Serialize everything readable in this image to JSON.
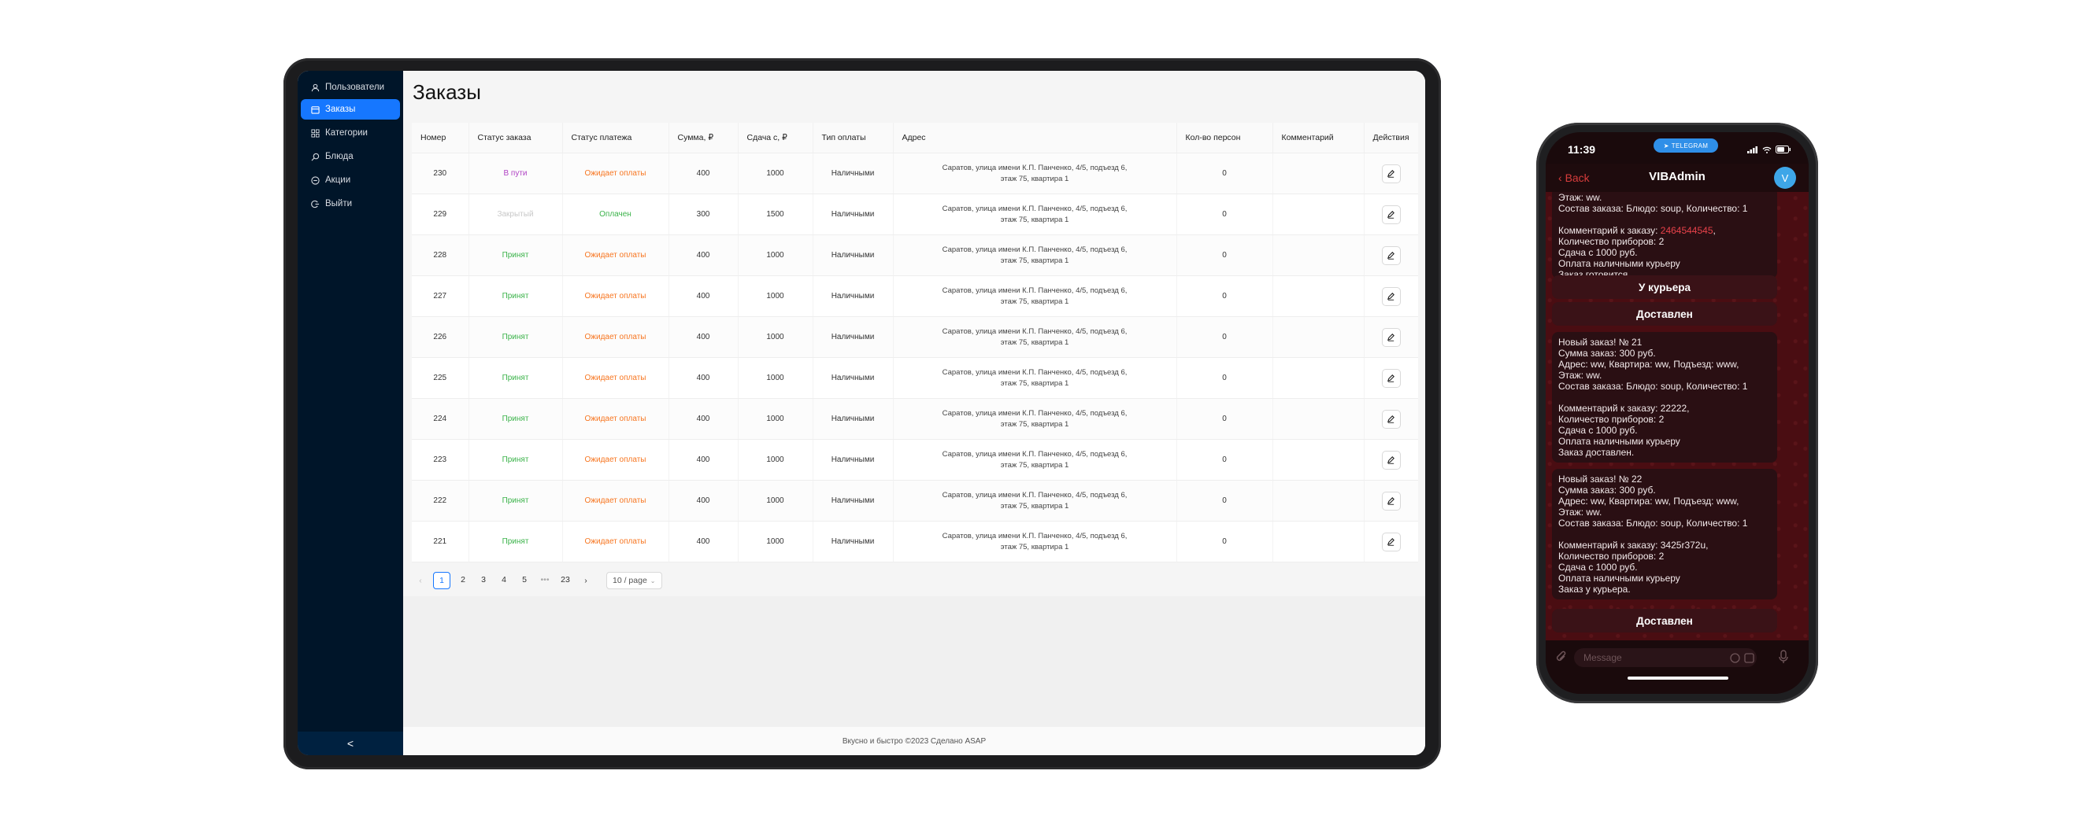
{
  "admin": {
    "title": "Заказы",
    "sidebar": [
      {
        "label": "Пользователи",
        "icon": "user-icon"
      },
      {
        "label": "Заказы",
        "icon": "calendar-icon",
        "active": true
      },
      {
        "label": "Категории",
        "icon": "grid-icon"
      },
      {
        "label": "Блюда",
        "icon": "search-icon"
      },
      {
        "label": "Акции",
        "icon": "tag-icon"
      },
      {
        "label": "Выйти",
        "icon": "logout-icon"
      }
    ],
    "collapse_label": "<",
    "columns": [
      "Номер",
      "Статус заказа",
      "Статус платежа",
      "Сумма, ₽",
      "Сдача с, ₽",
      "Тип оплаты",
      "Адрес",
      "Кол-во персон",
      "Комментарий",
      "Действия"
    ],
    "rows": [
      {
        "num": "230",
        "status": "В пути",
        "status_kind": "way",
        "pay": "Ожидает оплаты",
        "pay_kind": "wait",
        "sum": "400",
        "change": "1000",
        "type": "Наличными",
        "addr1": "Саратов, улица имени К.П. Панченко, 4/5, подъезд 6,",
        "addr2": "этаж 75, квартира 1",
        "persons": "0",
        "comment": ""
      },
      {
        "num": "229",
        "status": "Закрытый",
        "status_kind": "closed",
        "pay": "Оплачен",
        "pay_kind": "paid",
        "sum": "300",
        "change": "1500",
        "type": "Наличными",
        "addr1": "Саратов, улица имени К.П. Панченко, 4/5, подъезд 6,",
        "addr2": "этаж 75, квартира 1",
        "persons": "0",
        "comment": ""
      },
      {
        "num": "228",
        "status": "Принят",
        "status_kind": "accepted",
        "pay": "Ожидает оплаты",
        "pay_kind": "wait",
        "sum": "400",
        "change": "1000",
        "type": "Наличными",
        "addr1": "Саратов, улица имени К.П. Панченко, 4/5, подъезд 6,",
        "addr2": "этаж 75, квартира 1",
        "persons": "0",
        "comment": ""
      },
      {
        "num": "227",
        "status": "Принят",
        "status_kind": "accepted",
        "pay": "Ожидает оплаты",
        "pay_kind": "wait",
        "sum": "400",
        "change": "1000",
        "type": "Наличными",
        "addr1": "Саратов, улица имени К.П. Панченко, 4/5, подъезд 6,",
        "addr2": "этаж 75, квартира 1",
        "persons": "0",
        "comment": ""
      },
      {
        "num": "226",
        "status": "Принят",
        "status_kind": "accepted",
        "pay": "Ожидает оплаты",
        "pay_kind": "wait",
        "sum": "400",
        "change": "1000",
        "type": "Наличными",
        "addr1": "Саратов, улица имени К.П. Панченко, 4/5, подъезд 6,",
        "addr2": "этаж 75, квартира 1",
        "persons": "0",
        "comment": ""
      },
      {
        "num": "225",
        "status": "Принят",
        "status_kind": "accepted",
        "pay": "Ожидает оплаты",
        "pay_kind": "wait",
        "sum": "400",
        "change": "1000",
        "type": "Наличными",
        "addr1": "Саратов, улица имени К.П. Панченко, 4/5, подъезд 6,",
        "addr2": "этаж 75, квартира 1",
        "persons": "0",
        "comment": ""
      },
      {
        "num": "224",
        "status": "Принят",
        "status_kind": "accepted",
        "pay": "Ожидает оплаты",
        "pay_kind": "wait",
        "sum": "400",
        "change": "1000",
        "type": "Наличными",
        "addr1": "Саратов, улица имени К.П. Панченко, 4/5, подъезд 6,",
        "addr2": "этаж 75, квартира 1",
        "persons": "0",
        "comment": ""
      },
      {
        "num": "223",
        "status": "Принят",
        "status_kind": "accepted",
        "pay": "Ожидает оплаты",
        "pay_kind": "wait",
        "sum": "400",
        "change": "1000",
        "type": "Наличными",
        "addr1": "Саратов, улица имени К.П. Панченко, 4/5, подъезд 6,",
        "addr2": "этаж 75, квартира 1",
        "persons": "0",
        "comment": ""
      },
      {
        "num": "222",
        "status": "Принят",
        "status_kind": "accepted",
        "pay": "Ожидает оплаты",
        "pay_kind": "wait",
        "sum": "400",
        "change": "1000",
        "type": "Наличными",
        "addr1": "Саратов, улица имени К.П. Панченко, 4/5, подъезд 6,",
        "addr2": "этаж 75, квартира 1",
        "persons": "0",
        "comment": ""
      },
      {
        "num": "221",
        "status": "Принят",
        "status_kind": "accepted",
        "pay": "Ожидает оплаты",
        "pay_kind": "wait",
        "sum": "400",
        "change": "1000",
        "type": "Наличными",
        "addr1": "Саратов, улица имени К.П. Панченко, 4/5, подъезд 6,",
        "addr2": "этаж 75, квартира 1",
        "persons": "0",
        "comment": ""
      }
    ],
    "pagination": {
      "pages": [
        "1",
        "2",
        "3",
        "4",
        "5",
        "•••",
        "23"
      ],
      "current": "1",
      "page_size": "10 / page"
    },
    "footer": "Вкусно и быстро ©2023 Сделано ASAP"
  },
  "telegram": {
    "time": "11:39",
    "pill": "TELEGRAM",
    "back": "Back",
    "chat_title": "VIBAdmin",
    "avatar": "V",
    "msg1_top": "Этаж: ww.\nСостав заказа: Блюдо: soup, Количество: 1",
    "msg1_comment_label": "Комментарий к заказу: ",
    "msg1_comment_value": "2464544545",
    "msg1_rest": "Количество приборов: 2\nСдача с 1000 руб.\nОплата наличными курьеру\nЗаказ готовится.",
    "btn_courier": "У курьера",
    "btn_delivered1": "Доставлен",
    "msg2": "Новый заказ! № 21\nСумма заказ: 300 руб.\nАдрес: ww, Квартира: ww, Подъезд: www,\nЭтаж: ww.\nСостав заказа: Блюдо: soup, Количество: 1\n\nКомментарий к заказу: 22222,\nКоличество приборов: 2\nСдача с 1000 руб.\nОплата наличными курьеру\nЗаказ доставлен.",
    "msg3": "Новый заказ! № 22\nСумма заказ: 300 руб.\nАдрес: ww, Квартира: ww, Подъезд: www,\nЭтаж: ww.\nСостав заказа: Блюдо: soup, Количество: 1\n\nКомментарий к заказу: 3425r372u,\nКоличество приборов: 2\nСдача с 1000 руб.\nОплата наличными курьеру\nЗаказ у курьера.",
    "btn_delivered2": "Доставлен",
    "input_placeholder": "Message"
  }
}
